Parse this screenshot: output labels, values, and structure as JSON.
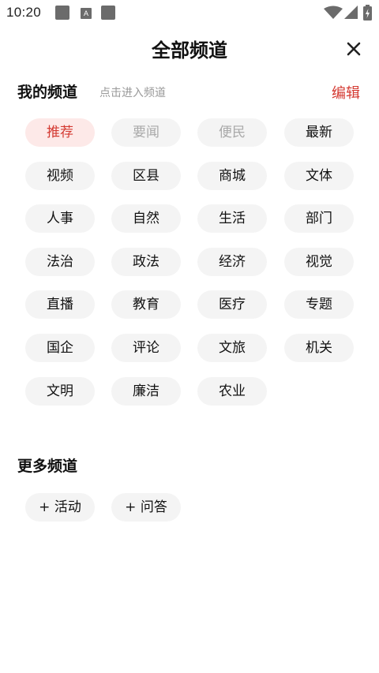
{
  "status_bar": {
    "time": "10:20",
    "icons": [
      "notification-square-icon",
      "a-badge-icon",
      "notification-square-icon",
      "wifi-icon",
      "signal-icon",
      "battery-charging-icon"
    ],
    "a_badge_letter": "A"
  },
  "header": {
    "title": "全部频道",
    "close_icon": "close-icon"
  },
  "my_channels": {
    "title": "我的频道",
    "hint": "点击进入频道",
    "edit_label": "编辑",
    "items": [
      {
        "label": "推荐",
        "state": "active"
      },
      {
        "label": "要闻",
        "state": "fixed"
      },
      {
        "label": "便民",
        "state": "fixed"
      },
      {
        "label": "最新",
        "state": "normal"
      },
      {
        "label": "视频",
        "state": "normal"
      },
      {
        "label": "区县",
        "state": "normal"
      },
      {
        "label": "商城",
        "state": "normal"
      },
      {
        "label": "文体",
        "state": "normal"
      },
      {
        "label": "人事",
        "state": "normal"
      },
      {
        "label": "自然",
        "state": "normal"
      },
      {
        "label": "生活",
        "state": "normal"
      },
      {
        "label": "部门",
        "state": "normal"
      },
      {
        "label": "法治",
        "state": "normal"
      },
      {
        "label": "政法",
        "state": "normal"
      },
      {
        "label": "经济",
        "state": "normal"
      },
      {
        "label": "视觉",
        "state": "normal"
      },
      {
        "label": "直播",
        "state": "normal"
      },
      {
        "label": "教育",
        "state": "normal"
      },
      {
        "label": "医疗",
        "state": "normal"
      },
      {
        "label": "专题",
        "state": "normal"
      },
      {
        "label": "国企",
        "state": "normal"
      },
      {
        "label": "评论",
        "state": "normal"
      },
      {
        "label": "文旅",
        "state": "normal"
      },
      {
        "label": "机关",
        "state": "normal"
      },
      {
        "label": "文明",
        "state": "normal"
      },
      {
        "label": "廉洁",
        "state": "normal"
      },
      {
        "label": "农业",
        "state": "normal"
      }
    ]
  },
  "more_channels": {
    "title": "更多频道",
    "items": [
      {
        "label": "+ 活动"
      },
      {
        "label": "+ 问答"
      }
    ]
  },
  "colors": {
    "accent": "#d43a32",
    "active_chip_bg": "#fde9e8",
    "chip_bg": "#f4f4f4",
    "hint_text": "#999999"
  }
}
